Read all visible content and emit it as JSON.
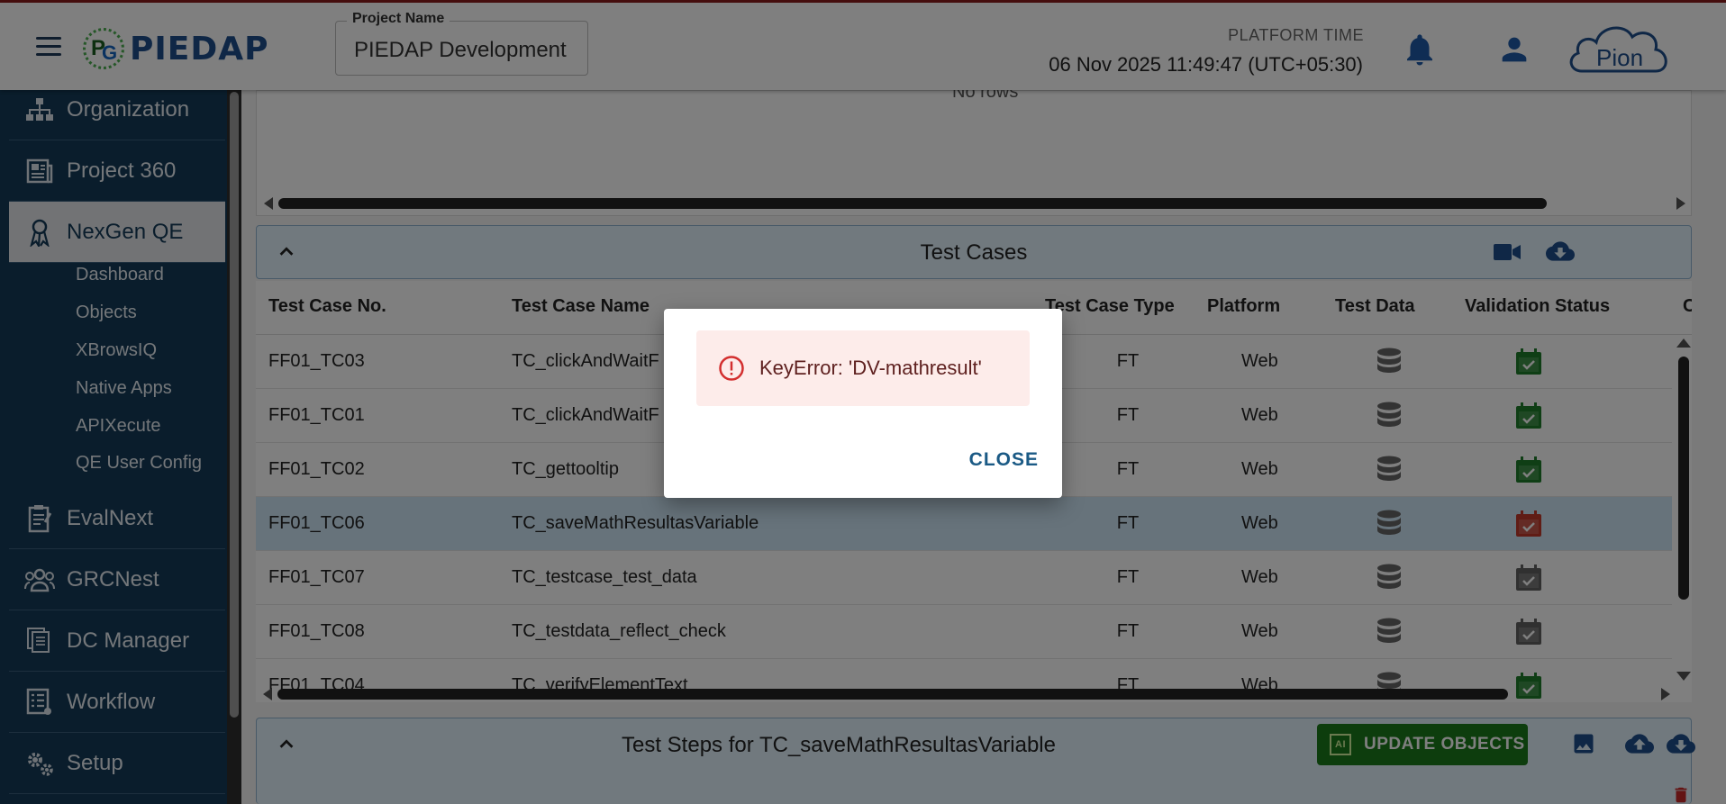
{
  "header": {
    "app_name": "PIEDAP",
    "project_label": "Project Name",
    "project_value": "PIEDAP Development",
    "platform_time_label": "PLATFORM TIME",
    "platform_time_value": "06 Nov 2025 11:49:47 (UTC+05:30)",
    "brand": "Pion"
  },
  "sidebar": {
    "items": [
      {
        "label": "Organization",
        "icon": "org-chart-icon"
      },
      {
        "label": "Project 360",
        "icon": "newspaper-icon"
      },
      {
        "label": "NexGen QE",
        "icon": "badge-icon"
      },
      {
        "label": "EvalNext",
        "icon": "clipboard-icon"
      },
      {
        "label": "GRCNest",
        "icon": "group-icon"
      },
      {
        "label": "DC Manager",
        "icon": "documents-icon"
      },
      {
        "label": "Workflow",
        "icon": "list-icon"
      },
      {
        "label": "Setup",
        "icon": "gears-icon"
      }
    ],
    "subitems": [
      "Dashboard",
      "Objects",
      "XBrowsIQ",
      "Native Apps",
      "APIXecute",
      "QE User Config"
    ],
    "active": "NexGen QE"
  },
  "top_panel": {
    "no_rows_text": "No rows"
  },
  "test_cases": {
    "title": "Test Cases",
    "columns": [
      "Test Case No.",
      "Test Case Name",
      "Test Case Type",
      "Platform",
      "Test Data",
      "Validation Status",
      "C"
    ],
    "rows": [
      {
        "no": "FF01_TC03",
        "name": "TC_clickAndWaitF",
        "type": "FT",
        "platform": "Web",
        "status": "valid"
      },
      {
        "no": "FF01_TC01",
        "name": "TC_clickAndWaitF",
        "type": "FT",
        "platform": "Web",
        "status": "valid"
      },
      {
        "no": "FF01_TC02",
        "name": "TC_gettooltip",
        "type": "FT",
        "platform": "Web",
        "status": "valid"
      },
      {
        "no": "FF01_TC06",
        "name": "TC_saveMathResultasVariable",
        "type": "FT",
        "platform": "Web",
        "status": "invalid"
      },
      {
        "no": "FF01_TC07",
        "name": "TC_testcase_test_data",
        "type": "FT",
        "platform": "Web",
        "status": "pending"
      },
      {
        "no": "FF01_TC08",
        "name": "TC_testdata_reflect_check",
        "type": "FT",
        "platform": "Web",
        "status": "pending"
      },
      {
        "no": "FF01_TC04",
        "name": "TC_verifyElementText",
        "type": "FT",
        "platform": "Web",
        "status": "valid"
      }
    ],
    "selected_row": 3
  },
  "test_steps": {
    "title": "Test Steps for TC_saveMathResultasVariable",
    "update_button": "UPDATE OBJECTS",
    "ai_badge": "AI"
  },
  "dialog": {
    "message": "KeyError: 'DV-mathresult'",
    "close_label": "CLOSE"
  },
  "colors": {
    "sidebar_bg": "#143b58",
    "valid": "#1e7d2a",
    "invalid": "#c0392b",
    "pending": "#616161",
    "accent": "#1b5a85"
  }
}
